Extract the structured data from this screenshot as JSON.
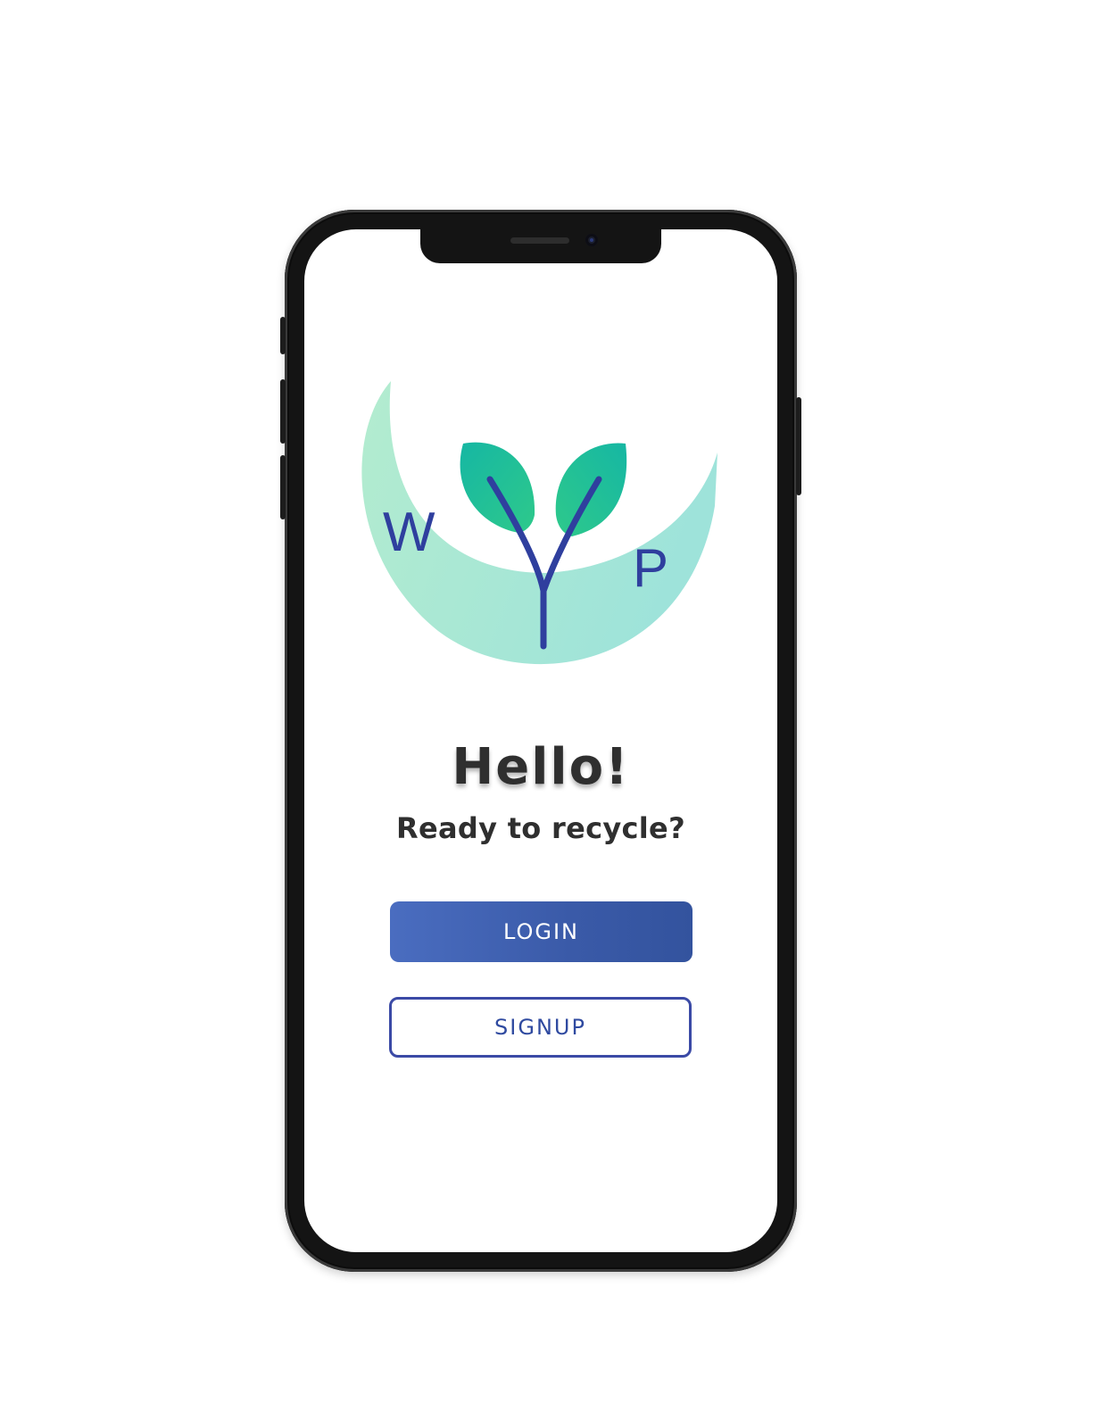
{
  "app": {
    "logo": {
      "letters": [
        "W",
        "P"
      ],
      "name": "wyp-logo"
    },
    "greeting": "Hello!",
    "tagline": "Ready to recycle?",
    "buttons": {
      "login_label": "LOGIN",
      "signup_label": "SIGNUP"
    }
  },
  "colors": {
    "primary": "#3a5aa8",
    "logo_blue": "#2f3f9e",
    "leaf_green": "#27c48a",
    "moon_mint": "#aeeccf",
    "text_dark": "#2f2f2f"
  }
}
